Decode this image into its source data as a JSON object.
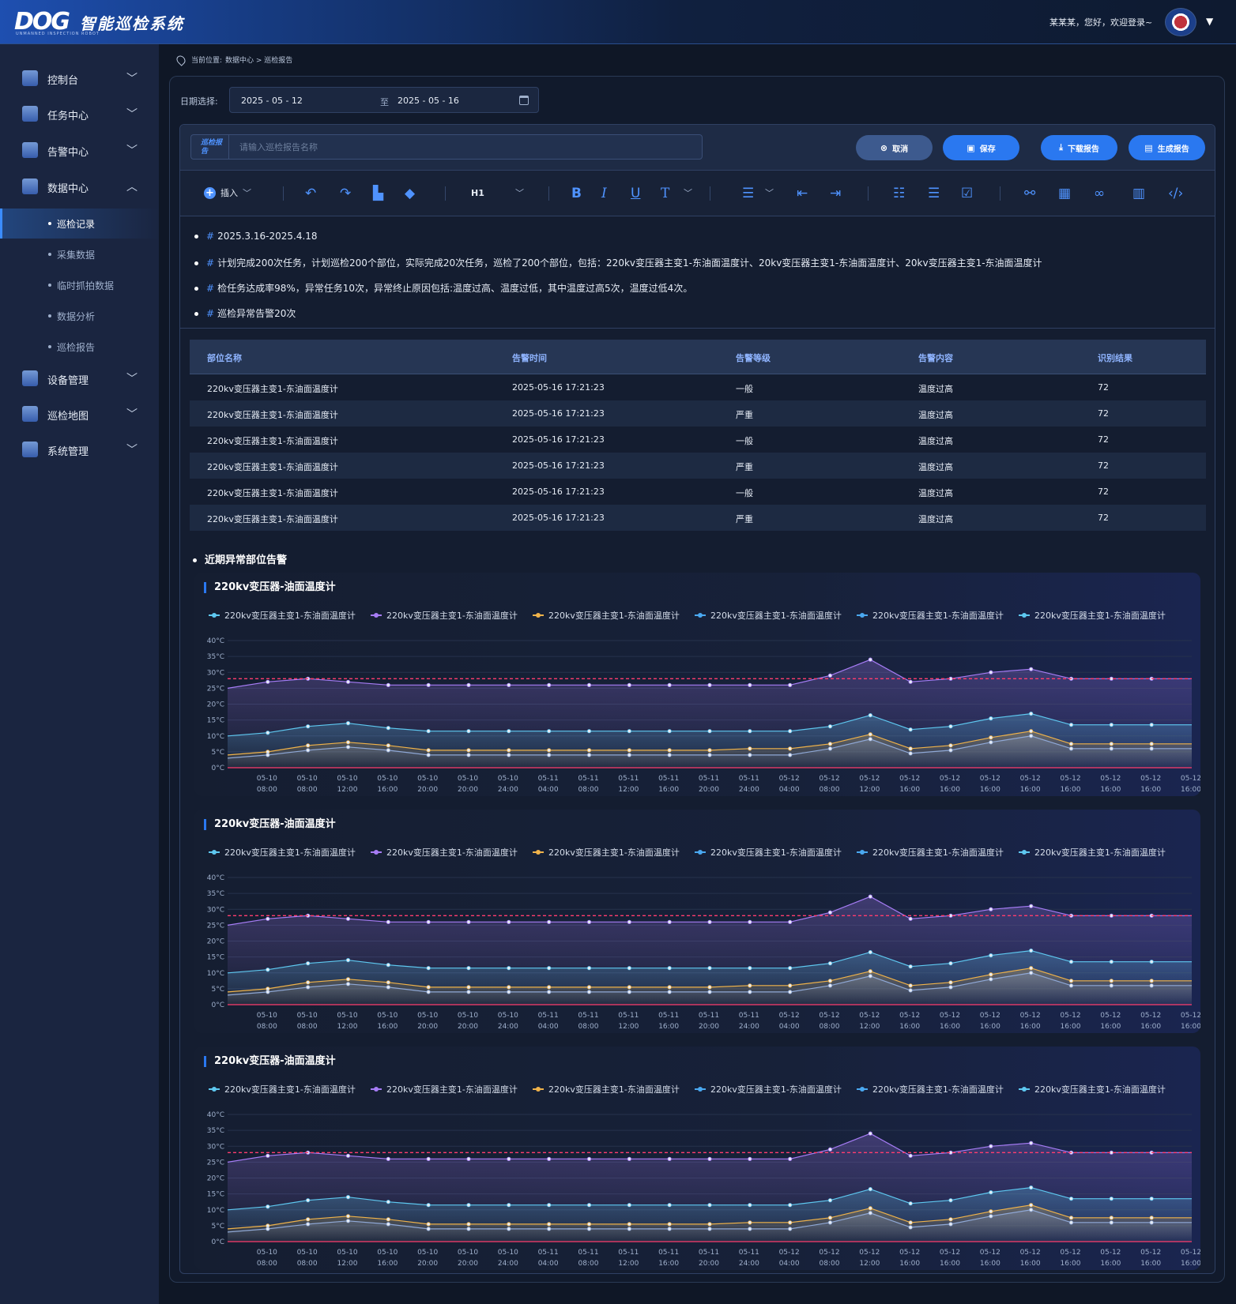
{
  "header": {
    "logo_mark": "DOG",
    "logo_sub": "UNMANNED INSPECTION ROBOT",
    "title": "智能巡检系统",
    "greeting": "某某某，您好，欢迎登录~"
  },
  "sidebar": {
    "items": [
      {
        "label": "控制台",
        "icon": "dashboard-icon"
      },
      {
        "label": "任务中心",
        "icon": "calendar-icon"
      },
      {
        "label": "告警中心",
        "icon": "alarm-icon"
      },
      {
        "label": "数据中心",
        "icon": "data-icon"
      },
      {
        "label": "设备管理",
        "icon": "device-icon"
      },
      {
        "label": "巡检地图",
        "icon": "map-icon"
      },
      {
        "label": "系统管理",
        "icon": "settings-icon"
      }
    ],
    "sub_items": [
      "巡检记录",
      "采集数据",
      "临时抓拍数据",
      "数据分析",
      "巡检报告"
    ]
  },
  "breadcrumb": {
    "prefix": "当前位置:",
    "path": "数据中心 > 巡检报告"
  },
  "date_filter": {
    "label": "日期选择:",
    "start": "2025 - 05 - 12",
    "separator": "至",
    "end": "2025 - 05 - 16"
  },
  "report": {
    "tag": "巡检报告",
    "name_placeholder": "请输入巡检报告名称",
    "buttons": {
      "cancel": "取消",
      "save": "保存",
      "download": "下载报告",
      "generate": "生成报告"
    },
    "toolbar": {
      "insert": "插入",
      "heading": "H1"
    }
  },
  "summary": [
    "2025.3.16-2025.4.18",
    "计划完成200次任务，计划巡检200个部位，实际完成20次任务，巡检了200个部位，包括：220kv变压器主变1-东油面温度计、20kv变压器主变1-东油面温度计、20kv变压器主变1-东油面温度计",
    "检任务达成率98%，异常任务10次，异常终止原因包括:温度过高、温度过低，其中温度过高5次，温度过低4次。",
    "巡检异常告警20次"
  ],
  "table": {
    "headers": [
      "部位名称",
      "告警时间",
      "告警等级",
      "告警内容",
      "识别结果"
    ],
    "rows": [
      [
        "220kv变压器主变1-东油面温度计",
        "2025-05-16 17:21:23",
        "一般",
        "温度过高",
        "72"
      ],
      [
        "220kv变压器主变1-东油面温度计",
        "2025-05-16 17:21:23",
        "严重",
        "温度过高",
        "72"
      ],
      [
        "220kv变压器主变1-东油面温度计",
        "2025-05-16 17:21:23",
        "一般",
        "温度过高",
        "72"
      ],
      [
        "220kv变压器主变1-东油面温度计",
        "2025-05-16 17:21:23",
        "严重",
        "温度过高",
        "72"
      ],
      [
        "220kv变压器主变1-东油面温度计",
        "2025-05-16 17:21:23",
        "一般",
        "温度过高",
        "72"
      ],
      [
        "220kv变压器主变1-东油面温度计",
        "2025-05-16 17:21:23",
        "严重",
        "温度过高",
        "72"
      ]
    ]
  },
  "recent_title": "近期异常部位告警",
  "chart_data": [
    {
      "type": "line",
      "title": "220kv变压器-油面温度计",
      "legend": [
        "220kv变压器主变1-东油面温度计",
        "220kv变压器主变1-东油面温度计",
        "220kv变压器主变1-东油面温度计",
        "220kv变压器主变1-东油面温度计",
        "220kv变压器主变1-东油面温度计",
        "220kv变压器主变1-东油面温度计"
      ],
      "legend_colors": [
        "#5ec8f0",
        "#a67cf5",
        "#f0b34a",
        "#4aa8f0",
        "#4aa8f0",
        "#5ec8f0"
      ],
      "y_ticks": [
        "40°C",
        "35°C",
        "30°C",
        "25°C",
        "20°C",
        "15°C",
        "10°C",
        "5°C",
        "0°C"
      ],
      "ylim": [
        0,
        40
      ],
      "threshold_values": [
        28,
        0
      ],
      "x_dates": [
        "05-10",
        "05-10",
        "05-10",
        "05-10",
        "05-10",
        "05-10",
        "05-10",
        "05-11",
        "05-11",
        "05-11",
        "05-11",
        "05-11",
        "05-11",
        "05-12",
        "05-12",
        "05-12",
        "05-12",
        "05-12",
        "05-12",
        "05-12",
        "05-12",
        "05-12",
        "05-12",
        "05-12"
      ],
      "x_times": [
        "08:00",
        "08:00",
        "12:00",
        "16:00",
        "20:00",
        "20:00",
        "24:00",
        "04:00",
        "08:00",
        "12:00",
        "16:00",
        "20:00",
        "24:00",
        "04:00",
        "08:00",
        "12:00",
        "16:00",
        "16:00",
        "16:00",
        "16:00",
        "16:00",
        "16:00",
        "16:00",
        "16:00"
      ],
      "series": [
        {
          "values": [
            25,
            27,
            28,
            27,
            26,
            26,
            26,
            26,
            26,
            26,
            26,
            26,
            26,
            26,
            26,
            29,
            34,
            27,
            28,
            30,
            31,
            28,
            28,
            28,
            28
          ],
          "color": "#a67cf5"
        },
        {
          "values": [
            10,
            11,
            13,
            14,
            12.5,
            11.5,
            11.5,
            11.5,
            11.5,
            11.5,
            11.5,
            11.5,
            11.5,
            11.5,
            11.5,
            13,
            16.5,
            12,
            13,
            15.5,
            17,
            13.5,
            13.5,
            13.5,
            13.5
          ],
          "color": "#5ec8f0"
        },
        {
          "values": [
            4,
            5,
            7,
            8,
            7,
            5.5,
            5.5,
            5.5,
            5.5,
            5.5,
            5.5,
            5.5,
            5.5,
            6,
            6,
            7.5,
            10.5,
            6,
            7,
            9.5,
            11.5,
            7.5,
            7.5,
            7.5,
            7.5
          ],
          "color": "#f0b34a"
        },
        {
          "values": [
            3,
            4,
            5.5,
            6.5,
            5.5,
            4,
            4,
            4,
            4,
            4,
            4,
            4,
            4,
            4,
            4,
            6,
            9,
            4.5,
            5.5,
            8,
            10,
            6,
            6,
            6,
            6
          ],
          "color": "#8fa8d6"
        }
      ]
    },
    {
      "type": "line",
      "title": "220kv变压器-油面温度计",
      "legend": [
        "220kv变压器主变1-东油面温度计",
        "220kv变压器主变1-东油面温度计",
        "220kv变压器主变1-东油面温度计",
        "220kv变压器主变1-东油面温度计",
        "220kv变压器主变1-东油面温度计",
        "220kv变压器主变1-东油面温度计"
      ],
      "legend_colors": [
        "#5ec8f0",
        "#a67cf5",
        "#f0b34a",
        "#4aa8f0",
        "#4aa8f0",
        "#5ec8f0"
      ],
      "y_ticks": [
        "40°C",
        "35°C",
        "30°C",
        "25°C",
        "20°C",
        "15°C",
        "10°C",
        "5°C",
        "0°C"
      ],
      "ylim": [
        0,
        40
      ],
      "threshold_values": [
        28,
        0
      ],
      "x_dates": [
        "05-10",
        "05-10",
        "05-10",
        "05-10",
        "05-10",
        "05-10",
        "05-10",
        "05-11",
        "05-11",
        "05-11",
        "05-11",
        "05-11",
        "05-11",
        "05-12",
        "05-12",
        "05-12",
        "05-12",
        "05-12",
        "05-12",
        "05-12",
        "05-12",
        "05-12",
        "05-12",
        "05-12"
      ],
      "x_times": [
        "08:00",
        "08:00",
        "12:00",
        "16:00",
        "20:00",
        "20:00",
        "24:00",
        "04:00",
        "08:00",
        "12:00",
        "16:00",
        "20:00",
        "24:00",
        "04:00",
        "08:00",
        "12:00",
        "16:00",
        "16:00",
        "16:00",
        "16:00",
        "16:00",
        "16:00",
        "16:00",
        "16:00"
      ],
      "series": [
        {
          "values": [
            25,
            27,
            28,
            27,
            26,
            26,
            26,
            26,
            26,
            26,
            26,
            26,
            26,
            26,
            26,
            29,
            34,
            27,
            28,
            30,
            31,
            28,
            28,
            28,
            28
          ],
          "color": "#a67cf5"
        },
        {
          "values": [
            10,
            11,
            13,
            14,
            12.5,
            11.5,
            11.5,
            11.5,
            11.5,
            11.5,
            11.5,
            11.5,
            11.5,
            11.5,
            11.5,
            13,
            16.5,
            12,
            13,
            15.5,
            17,
            13.5,
            13.5,
            13.5,
            13.5
          ],
          "color": "#5ec8f0"
        },
        {
          "values": [
            4,
            5,
            7,
            8,
            7,
            5.5,
            5.5,
            5.5,
            5.5,
            5.5,
            5.5,
            5.5,
            5.5,
            6,
            6,
            7.5,
            10.5,
            6,
            7,
            9.5,
            11.5,
            7.5,
            7.5,
            7.5,
            7.5
          ],
          "color": "#f0b34a"
        },
        {
          "values": [
            3,
            4,
            5.5,
            6.5,
            5.5,
            4,
            4,
            4,
            4,
            4,
            4,
            4,
            4,
            4,
            4,
            6,
            9,
            4.5,
            5.5,
            8,
            10,
            6,
            6,
            6,
            6
          ],
          "color": "#8fa8d6"
        }
      ]
    },
    {
      "type": "line",
      "title": "220kv变压器-油面温度计",
      "legend": [
        "220kv变压器主变1-东油面温度计",
        "220kv变压器主变1-东油面温度计",
        "220kv变压器主变1-东油面温度计",
        "220kv变压器主变1-东油面温度计",
        "220kv变压器主变1-东油面温度计",
        "220kv变压器主变1-东油面温度计"
      ],
      "legend_colors": [
        "#5ec8f0",
        "#a67cf5",
        "#f0b34a",
        "#4aa8f0",
        "#4aa8f0",
        "#5ec8f0"
      ],
      "y_ticks": [
        "40°C",
        "35°C",
        "30°C",
        "25°C",
        "20°C",
        "15°C",
        "10°C",
        "5°C",
        "0°C"
      ],
      "ylim": [
        0,
        40
      ],
      "threshold_values": [
        28,
        0
      ],
      "x_dates": [
        "05-10",
        "05-10",
        "05-10",
        "05-10",
        "05-10",
        "05-10",
        "05-10",
        "05-11",
        "05-11",
        "05-11",
        "05-11",
        "05-11",
        "05-11",
        "05-12",
        "05-12",
        "05-12",
        "05-12",
        "05-12",
        "05-12",
        "05-12",
        "05-12",
        "05-12",
        "05-12",
        "05-12"
      ],
      "x_times": [
        "08:00",
        "08:00",
        "12:00",
        "16:00",
        "20:00",
        "20:00",
        "24:00",
        "04:00",
        "08:00",
        "12:00",
        "16:00",
        "20:00",
        "24:00",
        "04:00",
        "08:00",
        "12:00",
        "16:00",
        "16:00",
        "16:00",
        "16:00",
        "16:00",
        "16:00",
        "16:00",
        "16:00"
      ],
      "series": [
        {
          "values": [
            25,
            27,
            28,
            27,
            26,
            26,
            26,
            26,
            26,
            26,
            26,
            26,
            26,
            26,
            26,
            29,
            34,
            27,
            28,
            30,
            31,
            28,
            28,
            28,
            28
          ],
          "color": "#a67cf5"
        },
        {
          "values": [
            10,
            11,
            13,
            14,
            12.5,
            11.5,
            11.5,
            11.5,
            11.5,
            11.5,
            11.5,
            11.5,
            11.5,
            11.5,
            11.5,
            13,
            16.5,
            12,
            13,
            15.5,
            17,
            13.5,
            13.5,
            13.5,
            13.5
          ],
          "color": "#5ec8f0"
        },
        {
          "values": [
            4,
            5,
            7,
            8,
            7,
            5.5,
            5.5,
            5.5,
            5.5,
            5.5,
            5.5,
            5.5,
            5.5,
            6,
            6,
            7.5,
            10.5,
            6,
            7,
            9.5,
            11.5,
            7.5,
            7.5,
            7.5,
            7.5
          ],
          "color": "#f0b34a"
        },
        {
          "values": [
            3,
            4,
            5.5,
            6.5,
            5.5,
            4,
            4,
            4,
            4,
            4,
            4,
            4,
            4,
            4,
            4,
            6,
            9,
            4.5,
            5.5,
            8,
            10,
            6,
            6,
            6,
            6
          ],
          "color": "#8fa8d6"
        }
      ]
    }
  ]
}
